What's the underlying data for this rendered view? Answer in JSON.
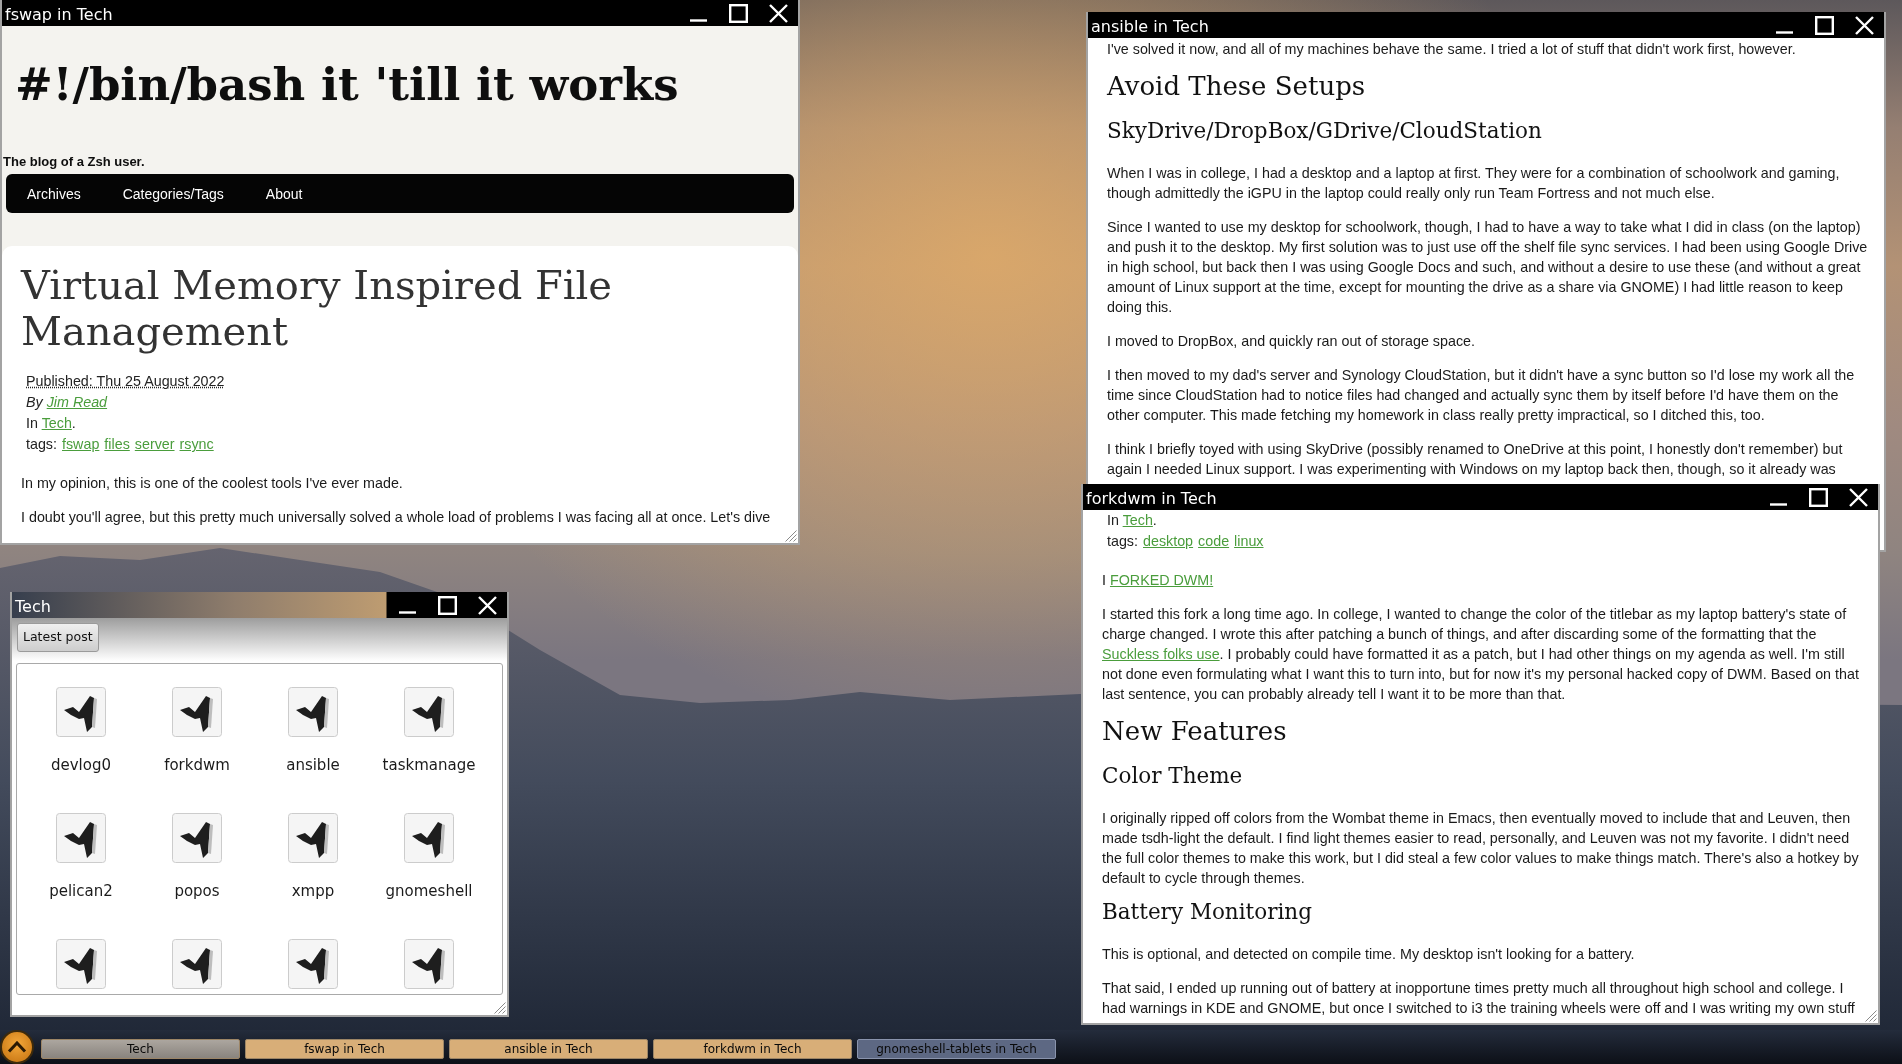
{
  "fswap_window": {
    "title": "fswap in Tech",
    "focused": false,
    "site_title": "#!/bin/bash it 'till it works",
    "tagline": "The blog of a Zsh user.",
    "nav": [
      "Archives",
      "Categories/Tags",
      "About"
    ],
    "post_title": "Virtual Memory Inspired File Management",
    "blocks": [
      {
        "kind": "published",
        "text": "Published: Thu 25 August 2022"
      },
      {
        "kind": "byline",
        "parts": [
          {
            "text": "By ",
            "link": false
          },
          {
            "text": "Jim Read",
            "link": true
          }
        ]
      },
      {
        "kind": "meta",
        "parts": [
          {
            "text": "In ",
            "link": false
          },
          {
            "text": "Tech",
            "link": true
          },
          {
            "text": ".",
            "link": false
          }
        ]
      },
      {
        "kind": "tags",
        "label": "tags:",
        "tags": [
          "fswap",
          "files",
          "server",
          "rsync"
        ]
      },
      {
        "kind": "p",
        "text": "In my opinion, this is one of the coolest tools I've ever made."
      },
      {
        "kind": "p",
        "text": "I doubt you'll agree, but this pretty much universally solved a whole load of problems I was facing all at once. Let's dive"
      }
    ]
  },
  "ansible_window": {
    "title": "ansible in Tech",
    "focused": false,
    "blocks": [
      {
        "kind": "p",
        "text": "I've solved it now, and all of my machines behave the same. I tried a lot of stuff that didn't work first, however."
      },
      {
        "kind": "h2",
        "text": "Avoid These Setups"
      },
      {
        "kind": "h3",
        "text": "SkyDrive/DropBox/GDrive/CloudStation"
      },
      {
        "kind": "p",
        "text": "When I was in college, I had a desktop and a laptop at first. They were for a combination of schoolwork and gaming, though admittedly the iGPU in the laptop could really only run Team Fortress and not much else."
      },
      {
        "kind": "p",
        "text": "Since I wanted to use my desktop for schoolwork, though, I had to have a way to take what I did in class (on the laptop) and push it to the desktop. My first solution was to just use off the shelf file sync services. I had been using Google Drive in high school, but back then I was using Google Docs and such, and without a desire to use these (and without a great amount of Linux support at the time, except for mounting the drive as a share via GNOME) I had little reason to keep doing this."
      },
      {
        "kind": "p",
        "text": "I moved to DropBox, and quickly ran out of storage space."
      },
      {
        "kind": "p",
        "text": "I then moved to my dad's server and Synology CloudStation, but it didn't have a sync button so I'd lose my work all the time since CloudStation had to notice files had changed and actually sync them by itself before I'd have them on the other computer. This made fetching my homework in class really pretty impractical, so I ditched this, too."
      },
      {
        "kind": "p",
        "text": "I think I briefly toyed with using SkyDrive (possibly renamed to OneDrive at this point, I honestly don't remember) but again I needed Linux support. I was experimenting with Windows on my laptop back then, though, so it already was"
      }
    ]
  },
  "forkdwm_window": {
    "title": "forkdwm in Tech",
    "focused": false,
    "blocks": [
      {
        "kind": "meta",
        "parts": [
          {
            "text": "In ",
            "link": false
          },
          {
            "text": "Tech",
            "link": true
          },
          {
            "text": ".",
            "link": false
          }
        ]
      },
      {
        "kind": "tags",
        "label": "tags:",
        "tags": [
          "desktop",
          "code",
          "linux"
        ]
      },
      {
        "kind": "p",
        "parts": [
          {
            "text": "I ",
            "link": false
          },
          {
            "text": "FORKED DWM!",
            "link": true
          }
        ]
      },
      {
        "kind": "p",
        "parts": [
          {
            "text": "I started this fork a long time ago. In college, I wanted to change the color of the titlebar as my laptop battery's state of charge changed. I wrote this after patching a bunch of things, and after discarding some of the formatting that the ",
            "link": false
          },
          {
            "text": "Suckless folks use",
            "link": true
          },
          {
            "text": ". I probably could have formatted it as a patch, but I had other things on my agenda as well. I'm still not done even formulating what I want this to turn into, but for now it's my personal hacked copy of DWM. Based on that last sentence, you can probably already tell I want it to be more than that.",
            "link": false
          }
        ]
      },
      {
        "kind": "h2",
        "text": "New Features"
      },
      {
        "kind": "h3",
        "text": "Color Theme"
      },
      {
        "kind": "p",
        "text": "I originally ripped off colors from the Wombat theme in Emacs, then eventually moved to include that and Leuven, then made tsdh-light the default. I find light themes easier to read, personally, and Leuven was not my favorite. I didn't need the full color themes to make this work, but I did steal a few color values to make things match. There's also a hotkey by default to cycle through themes."
      },
      {
        "kind": "h3",
        "text": "Battery Monitoring"
      },
      {
        "kind": "p",
        "text": "This is optional, and detected on compile time. My desktop isn't looking for a battery."
      },
      {
        "kind": "p",
        "text": "That said, I ended up running out of battery at inopportune times pretty much all throughout high school and college. I had warnings in KDE and GNOME, but once I switched to i3 the training wheels were off and I was writing my own stuff"
      }
    ]
  },
  "tech_window": {
    "title": "Tech",
    "focused": true,
    "toolbar_button": "Latest post",
    "items": [
      {
        "kind": "post",
        "label": "devlog0"
      },
      {
        "kind": "post",
        "label": "forkdwm"
      },
      {
        "kind": "post",
        "label": "ansible"
      },
      {
        "kind": "post",
        "label": "taskmanage"
      },
      {
        "kind": "post",
        "label": "pelican2"
      },
      {
        "kind": "post",
        "label": "popos"
      },
      {
        "kind": "post",
        "label": "xmpp"
      },
      {
        "kind": "post",
        "label": "gnomeshell"
      },
      {
        "kind": "post"
      },
      {
        "kind": "post"
      },
      {
        "kind": "post"
      },
      {
        "kind": "post"
      }
    ]
  },
  "taskbar": {
    "items": [
      {
        "label": "Tech",
        "selected": true,
        "minimized": false
      },
      {
        "label": "fswap in Tech",
        "selected": false,
        "minimized": false
      },
      {
        "label": "ansible in Tech",
        "selected": false,
        "minimized": false
      },
      {
        "label": "forkdwm in Tech",
        "selected": false,
        "minimized": false
      },
      {
        "label": "gnomeshell-tablets in Tech",
        "selected": false,
        "minimized": true
      }
    ]
  }
}
